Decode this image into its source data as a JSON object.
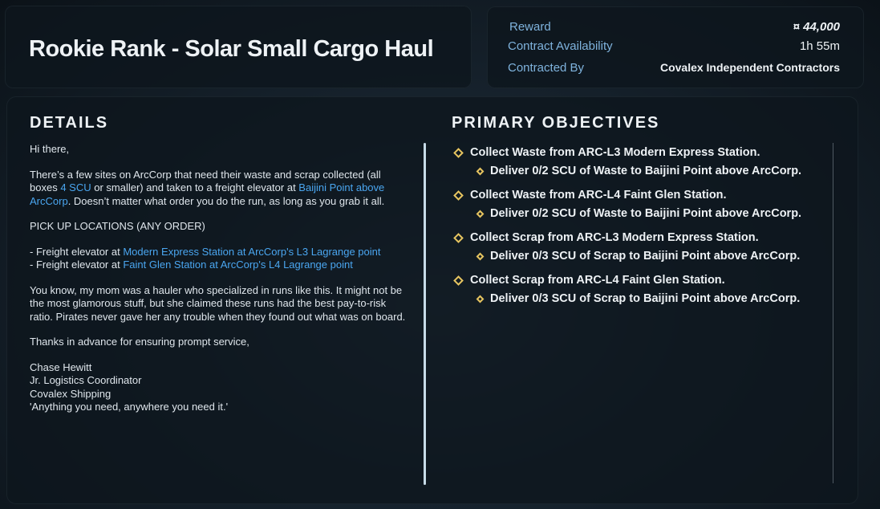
{
  "contract": {
    "title": "Rookie Rank - Solar Small Cargo Haul"
  },
  "info": {
    "reward_label": "Reward",
    "reward_value": "¤ 44,000",
    "availability_label": "Contract Availability",
    "availability_value": "1h 55m",
    "contracted_by_label": "Contracted By",
    "contracted_by_value": "Covalex Independent Contractors"
  },
  "details": {
    "heading": "DETAILS",
    "greeting": "Hi there,",
    "para1_a": "There’s a few sites on ArcCorp that need their waste and scrap collected (all boxes ",
    "para1_link1": "4 SCU",
    "para1_b": " or smaller) and taken to a freight elevator at ",
    "para1_link2": "Baijini Point above ArcCorp",
    "para1_c": ". Doesn’t matter what order you do the run, as long as you grab it all.",
    "pickup_heading": "PICK UP LOCATIONS (ANY ORDER)",
    "pickup1_prefix": "- Freight elevator at ",
    "pickup1_link": "Modern Express Station at ArcCorp's L3 Lagrange point",
    "pickup2_prefix": "- Freight elevator at ",
    "pickup2_link": "Faint Glen Station at ArcCorp's L4 Lagrange point",
    "para3": "You know, my mom was a hauler who specialized in runs like this. It might not be the most glamorous stuff, but she claimed these runs had the best pay-to-risk ratio. Pirates never gave her any trouble when they found out what was on board.",
    "thanks": "Thanks in advance for ensuring prompt service,",
    "sig_name": "Chase Hewitt",
    "sig_title": "Jr. Logistics Coordinator",
    "sig_company": "Covalex Shipping",
    "sig_motto": "'Anything you need, anywhere you need it.'"
  },
  "objectives": {
    "heading": "PRIMARY OBJECTIVES",
    "items": [
      {
        "main": "Collect Waste from ARC-L3 Modern Express Station.",
        "sub": "Deliver 0/2 SCU of Waste to Baijini Point above ArcCorp."
      },
      {
        "main": "Collect Waste from ARC-L4 Faint Glen Station.",
        "sub": "Deliver 0/2 SCU of Waste to Baijini Point above ArcCorp."
      },
      {
        "main": "Collect Scrap from ARC-L3 Modern Express Station.",
        "sub": "Deliver 0/3 SCU of Scrap to Baijini Point above ArcCorp."
      },
      {
        "main": "Collect Scrap from ARC-L4 Faint Glen Station.",
        "sub": "Deliver 0/3 SCU of Scrap to Baijini Point above ArcCorp."
      }
    ]
  },
  "colors": {
    "accent_blue": "#4aa6f0",
    "label_blue": "#7fb3dd",
    "objective_diamond": "#e7c560"
  }
}
